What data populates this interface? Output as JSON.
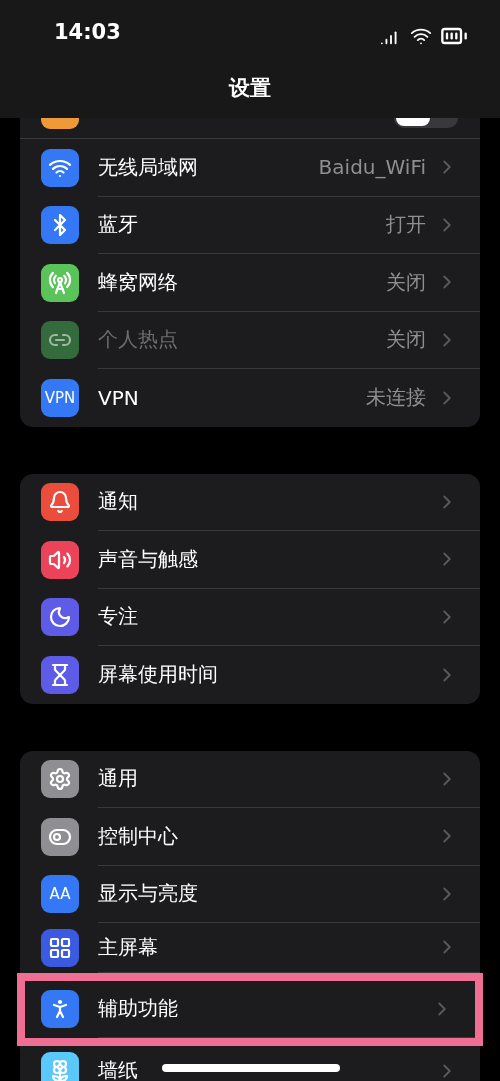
{
  "status_bar": {
    "time": "14:03"
  },
  "title": "设置",
  "groups": [
    {
      "items": [
        {
          "kind": "partial-toggle",
          "color": "#f09a37",
          "on": false
        },
        {
          "kind": "link",
          "color": "#3478f6",
          "label": "无线局域网",
          "value": "Baidu_WiFi",
          "disabled": false
        },
        {
          "kind": "link",
          "color": "#3478f6",
          "label": "蓝牙",
          "value": "打开",
          "disabled": false
        },
        {
          "kind": "link",
          "color": "#5ac35a",
          "label": "蜂窝网络",
          "value": "关闭",
          "disabled": false
        },
        {
          "kind": "link",
          "color": "#336b3c",
          "label": "个人热点",
          "value": "关闭",
          "disabled": true
        },
        {
          "kind": "link",
          "icon_text": "VPN",
          "color": "#3478f6",
          "label": "VPN",
          "value": "未连接",
          "disabled": false
        }
      ]
    },
    {
      "items": [
        {
          "kind": "link",
          "color": "#eb4d3d",
          "label": "通知",
          "disabled": false
        },
        {
          "kind": "link",
          "color": "#eb445a",
          "label": "声音与触感",
          "disabled": false
        },
        {
          "kind": "link",
          "color": "#5e5ce6",
          "label": "专注",
          "disabled": false
        },
        {
          "kind": "link",
          "color": "#5e5ce6",
          "label": "屏幕使用时间",
          "disabled": false
        }
      ]
    },
    {
      "items": [
        {
          "kind": "link",
          "color": "#8e8e93",
          "label": "通用",
          "disabled": false
        },
        {
          "kind": "link",
          "color": "#8e8e93",
          "label": "控制中心",
          "disabled": false
        },
        {
          "kind": "link",
          "icon_text": "AA",
          "color": "#3478f6",
          "label": "显示与亮度",
          "disabled": false
        },
        {
          "kind": "link",
          "color": "#3a5be0",
          "label": "主屏幕",
          "disabled": false
        },
        {
          "kind": "link",
          "color": "#3478f6",
          "label": "辅助功能",
          "disabled": false,
          "highlighted": true
        },
        {
          "kind": "link",
          "color": "#5ac8fa",
          "label": "墙纸",
          "disabled": false
        }
      ]
    }
  ]
}
